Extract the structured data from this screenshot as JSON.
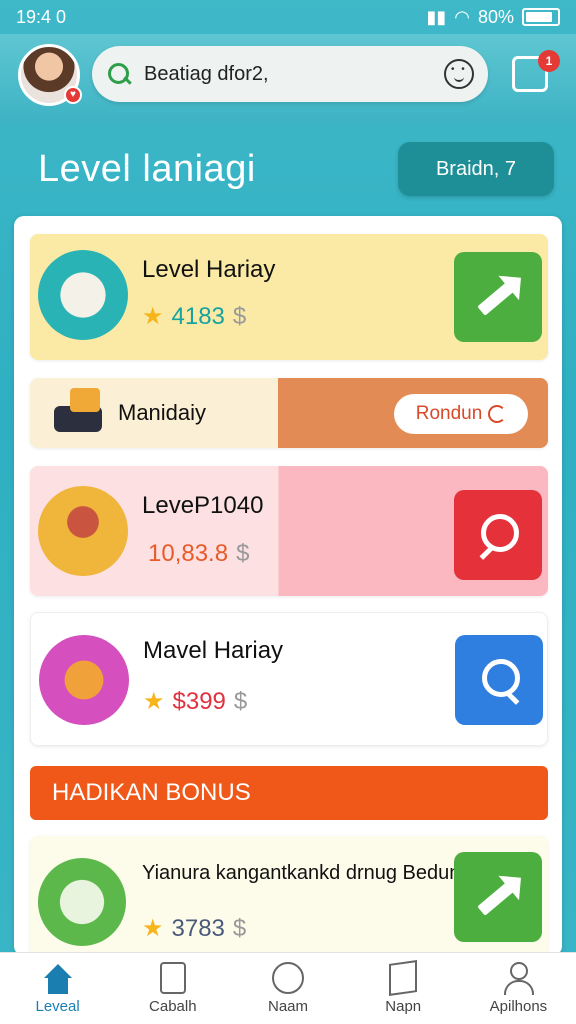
{
  "status_bar": {
    "time": "19:4 0",
    "battery": "80%"
  },
  "header": {
    "search_text": "Beatiag dfor2,",
    "notification_count": "1"
  },
  "page": {
    "title": "Level laniagi",
    "action_label": "Braidn, 7"
  },
  "cards": [
    {
      "title": "Level Hariay",
      "value": "4183",
      "currency": "$",
      "action_icon": "arrow-icon"
    },
    {
      "title": "Manidaiy",
      "button_label": "Rondun"
    },
    {
      "title": "LeveP1040",
      "value": "10,83.8",
      "currency": "$",
      "action_icon": "search-icon"
    },
    {
      "title": "Mavel Hariay",
      "value": "$399",
      "currency": "$",
      "action_icon": "search-icon"
    },
    {
      "title": "Yianura kangantkankd drnug Bedun",
      "value": "3783",
      "currency": "$",
      "action_icon": "arrow-icon"
    }
  ],
  "bonus_banner": "HADIKAN BONUS",
  "nav": [
    {
      "label": "Leveal",
      "icon": "home-icon",
      "active": true
    },
    {
      "label": "Cabalh",
      "icon": "clipboard-icon"
    },
    {
      "label": "Naam",
      "icon": "clock-icon"
    },
    {
      "label": "Napn",
      "icon": "box-icon"
    },
    {
      "label": "Apilhons",
      "icon": "user-icon"
    }
  ],
  "colors": {
    "accent": "#1a7fb0",
    "green": "#4cae3f",
    "red": "#e5323a",
    "blue": "#2f7fe0",
    "orange": "#f0581a"
  }
}
